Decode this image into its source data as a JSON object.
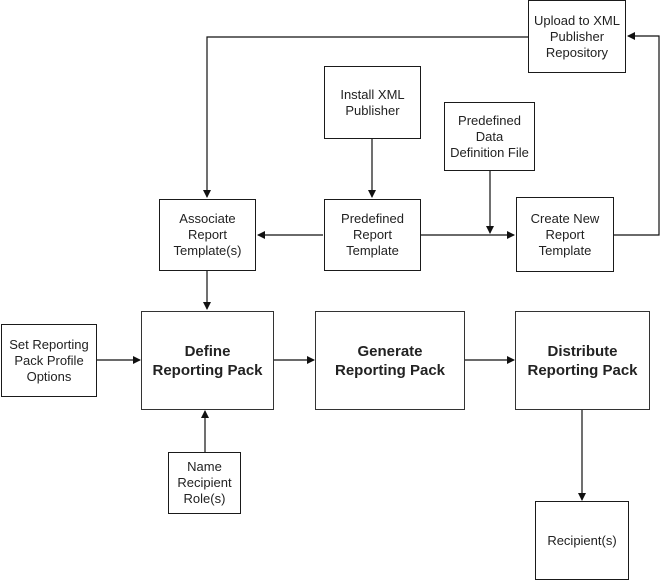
{
  "diagram": {
    "nodes": {
      "upload": "Upload to XML\nPublisher\nRepository",
      "install": "Install XML\nPublisher",
      "data_def": "Predefined\nData\nDefinition File",
      "associate": "Associate\nReport\nTemplate(s)",
      "predefined_template": "Predefined\nReport\nTemplate",
      "create_new": "Create New\nReport\nTemplate",
      "set_profile": "Set Reporting\nPack Profile\nOptions",
      "define": "Define\nReporting Pack",
      "generate": "Generate\nReporting Pack",
      "distribute": "Distribute\nReporting Pack",
      "name_roles": "Name\nRecipient\nRole(s)",
      "recipients": "Recipient(s)"
    },
    "edges": [
      [
        "install",
        "predefined_template"
      ],
      [
        "predefined_template",
        "associate"
      ],
      [
        "predefined_template",
        "create_new"
      ],
      [
        "data_def",
        "create_new"
      ],
      [
        "create_new",
        "upload"
      ],
      [
        "upload",
        "associate"
      ],
      [
        "associate",
        "define"
      ],
      [
        "set_profile",
        "define"
      ],
      [
        "name_roles",
        "define"
      ],
      [
        "define",
        "generate"
      ],
      [
        "generate",
        "distribute"
      ],
      [
        "distribute",
        "recipients"
      ]
    ]
  }
}
